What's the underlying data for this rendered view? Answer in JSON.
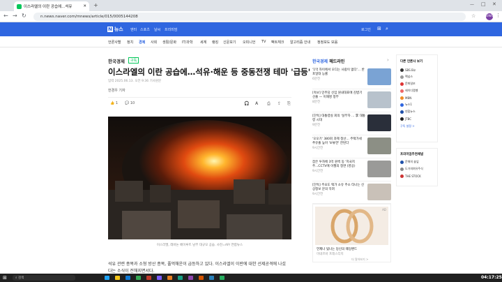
{
  "browser": {
    "tab_title": "이스라엘의 이란 공습에...석유",
    "url": "n.news.naver.com/mnews/article/015/0005144208",
    "avatar": "UWU"
  },
  "naver": {
    "logo": "N",
    "logo_text": "뉴스",
    "menu": [
      "엔터",
      "스포츠",
      "날씨",
      "프리미엄"
    ],
    "login": "로그인"
  },
  "sections": [
    "언론사별",
    "정치",
    "경제",
    "사회",
    "생활/문화",
    "IT/과학",
    "세계",
    "랭킹",
    "신문보기",
    "오피니언",
    "TV",
    "팩트체크",
    "알고리즘 안내",
    "정정보도 모음"
  ],
  "article": {
    "press": "한국경제",
    "subscribe": "구독",
    "title": "이스라엘의 이란 공습에…석유·해운 등 중동전쟁 테마 '급등'",
    "date": "입력 2025.06.13. 오전 9:36    기사원문",
    "reporter": "한경우 기자",
    "reactions": "1",
    "comments": "10",
    "caption": "이스라엘, 레바논 베이루트 남부 대규모 공습. 사진=AP/ 연합뉴스",
    "body1": "석유 관련 종목과 소형 방산 종목, 풀먹해운이 급등하고 있다. 이스라엘이 이란에 대한 선제공격에 나섰",
    "body2": "다는 소식이 전해지면서다."
  },
  "side": {
    "press": "한국경제",
    "heading": "헤드라인",
    "items": [
      {
        "text": "'1억 자이에서 오디는 사람이 없다'... 반포일대 능률",
        "time": "6분전"
      },
      {
        "text": "[속보] 민주당 신임 원내대표에 김병기 선출 — 이재명 정부",
        "time": "8분전"
      },
      {
        "text": "[단독] 대통령실 회의 '실무자 ... 李 대통령 시대",
        "time": "9분전"
      },
      {
        "text": "'오오기' 380회 과제 청산... 주택가세 추유출 높아 '보류한' 한된다",
        "time": "9시간전"
      },
      {
        "text": "잡은 투자에 3억 원씩 동 '지국지 주...CCTV에 이젤의 정면 (영상)",
        "time": "9시간전"
      },
      {
        "text": "[단독] 주요도 택가 소유 주소 타나는 신상정보 문의 막혀",
        "time": "9시간전"
      }
    ],
    "ad_text": "언제나 빛나는 당신의 웨딩밴드",
    "ad_brand": "미네르바 프레스티지",
    "ad_label": "AD",
    "ad_more": "더 알아보기 >"
  },
  "right": {
    "title1": "다른 언론사 보기",
    "items1": [
      "SBS Biz",
      "팩넘스",
      "문화일보",
      "헤이디랭벨",
      "MBN",
      "뉴스1",
      "연합뉴스",
      "JTBC"
    ],
    "more1": "구독 설정 >",
    "title2": "프리미엄추천채널",
    "items2": [
      "문해의 솔잎",
      "도가의여유주식",
      "THE STOCK"
    ]
  },
  "taskbar": {
    "search": "검색",
    "time": "04:17:25"
  },
  "colors": {
    "naver_blue": "#2f66e0",
    "naver_green": "#03c75a"
  }
}
